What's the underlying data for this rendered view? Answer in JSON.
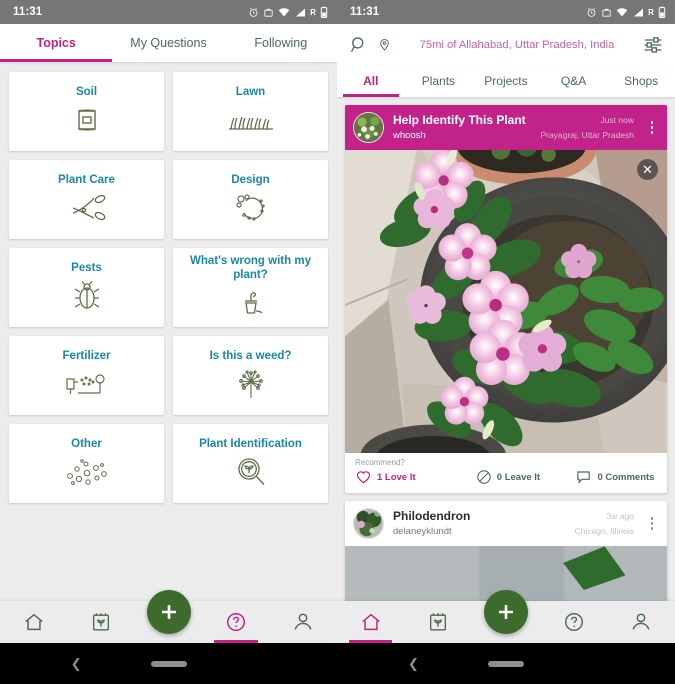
{
  "status_bar": {
    "time": "11:31",
    "roaming": "R",
    "icons": [
      "alarm-icon",
      "bag-icon",
      "wifi-icon",
      "signal-icon",
      "roaming-indicator",
      "battery-icon"
    ]
  },
  "colors": {
    "accent_pink": "#bd2483",
    "header_pink": "#c2238a",
    "title_teal": "#1b87a8",
    "icon_green": "#5d6f49",
    "nav_green": "#4d6b52",
    "fab_green": "#3c6b2b",
    "page_bg": "#ececec",
    "status_bar_bg": "#767676"
  },
  "left_screen": {
    "tabs": [
      {
        "label": "Topics",
        "active": true
      },
      {
        "label": "My Questions",
        "active": false
      },
      {
        "label": "Following",
        "active": false
      }
    ],
    "topics": [
      {
        "label": "Soil",
        "icon": "soil-bag-icon"
      },
      {
        "label": "Lawn",
        "icon": "grass-icon"
      },
      {
        "label": "Plant Care",
        "icon": "pruning-shears-icon"
      },
      {
        "label": "Design",
        "icon": "garden-design-icon"
      },
      {
        "label": "Pests",
        "icon": "beetle-icon"
      },
      {
        "label": "What's wrong with my plant?",
        "icon": "wilting-plant-icon"
      },
      {
        "label": "Fertilizer",
        "icon": "fertilizer-spray-icon"
      },
      {
        "label": "Is this a weed?",
        "icon": "dandelion-icon"
      },
      {
        "label": "Other",
        "icon": "scattered-dots-icon"
      },
      {
        "label": "Plant Identification",
        "icon": "magnifier-leaf-icon"
      }
    ],
    "bottom_nav": [
      {
        "label": "Home",
        "icon": "home-icon",
        "active": false
      },
      {
        "label": "My Plants",
        "icon": "plant-calendar-icon",
        "active": false
      },
      {
        "label": "Add",
        "icon": "plus-icon",
        "active": false
      },
      {
        "label": "Help",
        "icon": "question-circle-icon",
        "active": true
      },
      {
        "label": "Profile",
        "icon": "person-icon",
        "active": false
      }
    ]
  },
  "right_screen": {
    "search": {
      "search_icon": "search-icon",
      "pin_icon": "location-pin-icon",
      "location": "75mi of Allahabad, Uttar Pradesh, India",
      "filter_icon": "filter-sliders-icon"
    },
    "filter_tabs": [
      {
        "label": "All",
        "active": true
      },
      {
        "label": "Plants",
        "active": false
      },
      {
        "label": "Projects",
        "active": false
      },
      {
        "label": "Q&A",
        "active": false
      },
      {
        "label": "Shops",
        "active": false
      }
    ],
    "posts": [
      {
        "title": "Help Identify This Plant",
        "user": "whoosh",
        "time": "Just now",
        "place": "Prayagraj, Uttar Pradesh",
        "header_style": "magenta",
        "menu_icon": "kebab-menu-icon",
        "close_icon": "close-icon",
        "photo_alt": "pink periwinkle flowers in a dark pot on stone pavement",
        "recommend_label": "Recommend?",
        "love_label": "1 Love It",
        "leave_label": "0 Leave It",
        "comments_label": "0 Comments",
        "love_icon": "heart-icon",
        "leave_icon": "no-entry-icon",
        "comment_icon": "speech-bubble-icon"
      },
      {
        "title": "Philodendron",
        "user": "delaneyklundt",
        "time": "3w ago",
        "place": "Chicago, Illinois",
        "header_style": "plain",
        "menu_icon": "kebab-menu-icon"
      }
    ],
    "bottom_nav": [
      {
        "label": "Home",
        "icon": "home-icon",
        "active": true
      },
      {
        "label": "My Plants",
        "icon": "plant-calendar-icon",
        "active": false
      },
      {
        "label": "Add",
        "icon": "plus-icon",
        "active": false
      },
      {
        "label": "Help",
        "icon": "question-circle-icon",
        "active": false
      },
      {
        "label": "Profile",
        "icon": "person-icon",
        "active": false
      }
    ]
  },
  "system_nav": {
    "back_icon": "back-chevron-icon",
    "home_pill": "home-pill"
  }
}
